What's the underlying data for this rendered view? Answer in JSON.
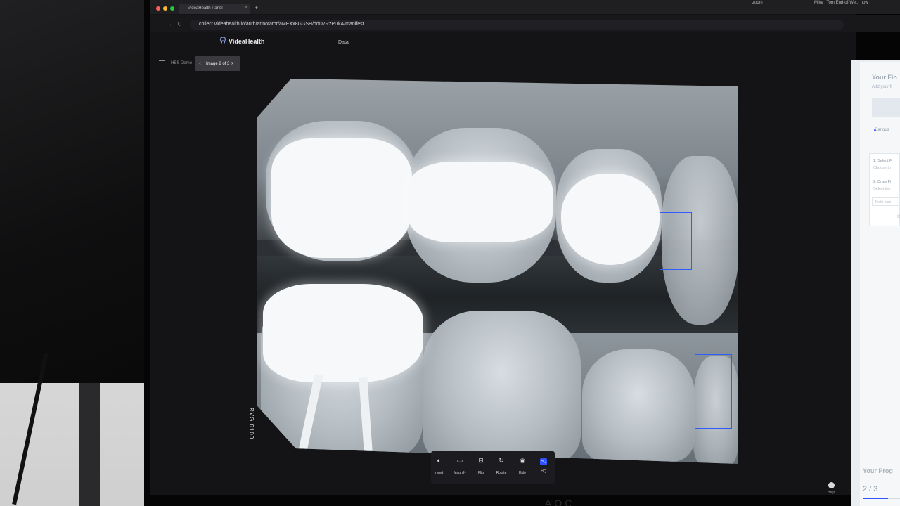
{
  "browser": {
    "tab_title": "VideaHealth Panel",
    "tab_close": "×",
    "new_tab": "+",
    "url": "collect.videahealth.io/auth/annotator/aMEXx8GGSH/ddD7RzPDkA/manifest",
    "status_app": "zoom",
    "status_user": "Mike : Tom End-of-We... now"
  },
  "app": {
    "brand": "VideaHealth",
    "nav_data": "Data",
    "project": "HBS Demo",
    "image_nav": {
      "prev": "‹",
      "label": "Image 2 of 3",
      "next": "›"
    }
  },
  "xray": {
    "sensor_label": "RVG 6100"
  },
  "toolbar": {
    "tools": [
      {
        "label": "Invert",
        "icon": "◐"
      },
      {
        "label": "Magnify",
        "icon": "▭"
      },
      {
        "label": "Flip",
        "icon": "⊟"
      },
      {
        "label": "Rotate",
        "icon": "↻"
      },
      {
        "label": "Hide",
        "icon": "◉"
      },
      {
        "label": "HQ",
        "icon": "HQ"
      }
    ]
  },
  "help": {
    "label": "Help"
  },
  "side_panel": {
    "title": "Your Fin",
    "subtitle": "Add your fi",
    "carious": "Carious",
    "step1": "1. Select F",
    "step1_sub": "Choose th",
    "step2": "2. Draw Fi",
    "step2_sub": "Select the",
    "tooth_placeholder": "Tooth num",
    "c_label": "C",
    "progress_title": "Your Prog",
    "progress_value": "2 / 3",
    "progress_fraction": 0.67
  },
  "colors": {
    "accent": "#2f54ff",
    "screen_bg": "#141416"
  }
}
